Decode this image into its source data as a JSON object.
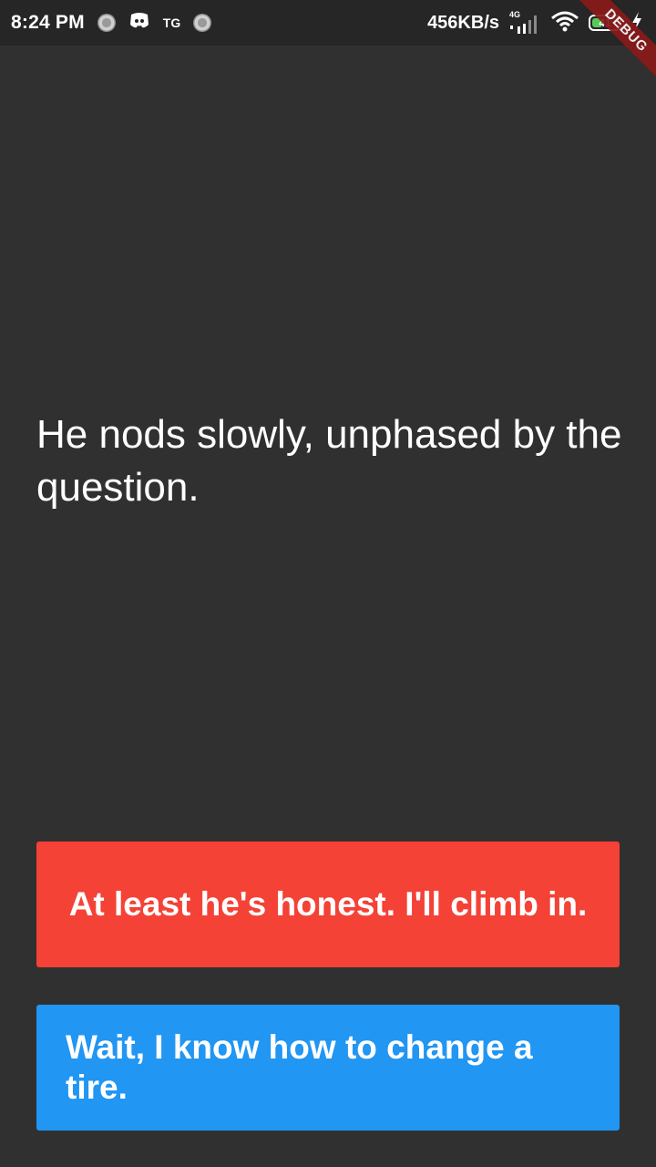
{
  "status_bar": {
    "time": "8:24 PM",
    "tg_label": "TG",
    "net_speed": "456KB/s",
    "network_type": "4G",
    "battery_level": "41",
    "battery_fraction": 0.41,
    "icons": [
      "notification-dot-icon",
      "discord-icon",
      "notification-dot-icon",
      "signal-icon",
      "wifi-icon",
      "battery-icon",
      "charging-icon"
    ]
  },
  "debug_banner": "DEBUG",
  "story": {
    "text": "He nods slowly, unphased by the question."
  },
  "choices": [
    {
      "label": "At least he's honest. I'll climb in.",
      "color": "#f44236"
    },
    {
      "label": "Wait, I know how to change a tire.",
      "color": "#2196f3"
    }
  ],
  "colors": {
    "background": "#303030",
    "status_bar": "#262626",
    "debug_ribbon": "#8b1a1a"
  }
}
